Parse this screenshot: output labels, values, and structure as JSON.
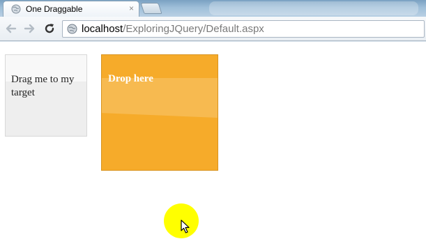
{
  "browser": {
    "tab": {
      "title": "One Draggable",
      "close_glyph": "×",
      "favicon": "globe-icon"
    },
    "toolbar": {
      "back_icon": "back-arrow-icon",
      "forward_icon": "forward-arrow-icon",
      "reload_icon": "reload-icon"
    },
    "address": {
      "host": "localhost",
      "path": "/ExploringJQuery/Default.aspx",
      "icon": "globe-icon"
    }
  },
  "page": {
    "draggable": {
      "label": "Drag me to my target",
      "color": "#eeeeee"
    },
    "droppable": {
      "label": "Drop here",
      "color": "#f6ab2a"
    },
    "cursor_highlight_color": "#ffff00"
  }
}
